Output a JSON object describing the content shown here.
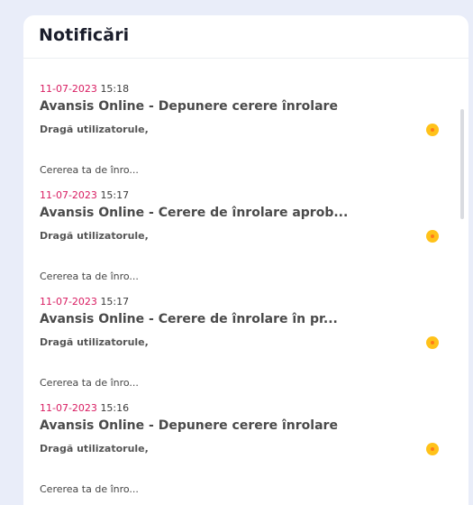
{
  "panel": {
    "title": "Notificări"
  },
  "notifications": [
    {
      "date": "11-07-2023",
      "time": "15:18",
      "subject": "Avansis Online - Depunere cerere înrolare",
      "greeting": "Dragă utilizatorule,",
      "preview": "Cererea ta de înro..."
    },
    {
      "date": "11-07-2023",
      "time": "15:17",
      "subject": "Avansis Online - Cerere de înrolare aprob...",
      "greeting": "Dragă utilizatorule,",
      "preview": "Cererea ta de înro..."
    },
    {
      "date": "11-07-2023",
      "time": "15:17",
      "subject": "Avansis Online - Cerere de înrolare în pr...",
      "greeting": "Dragă utilizatorule,",
      "preview": "Cererea ta de înro..."
    },
    {
      "date": "11-07-2023",
      "time": "15:16",
      "subject": "Avansis Online - Depunere cerere înrolare",
      "greeting": "Dragă utilizatorule,",
      "preview": "Cererea ta de înro..."
    }
  ],
  "colors": {
    "background": "#e9edf9",
    "date": "#d81b60",
    "unread_dot": "#ffc21a",
    "unread_dot_center": "#ff7a1a"
  },
  "icons": {
    "unread": "unread-dot-icon"
  }
}
